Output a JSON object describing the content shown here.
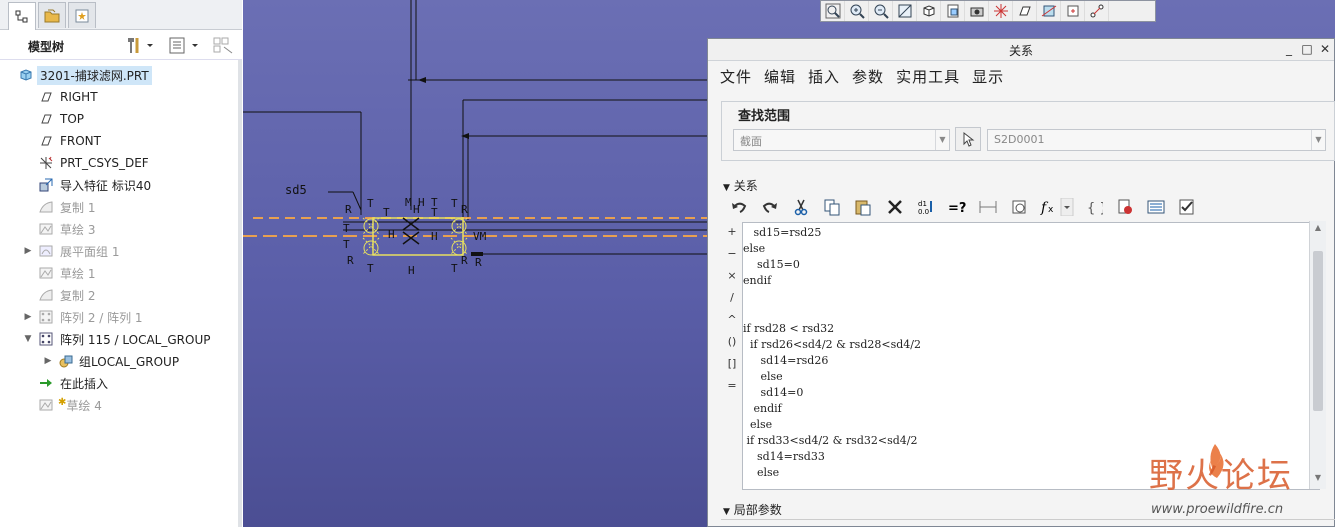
{
  "model_tree": {
    "header_title": "模型树",
    "items": [
      {
        "label": "3201-捕球滤网.PRT",
        "icon": "part-icon",
        "state": "selected"
      },
      {
        "label": "RIGHT",
        "icon": "datum-plane-icon",
        "state": "normal"
      },
      {
        "label": "TOP",
        "icon": "datum-plane-icon",
        "state": "normal"
      },
      {
        "label": "FRONT",
        "icon": "datum-plane-icon",
        "state": "normal"
      },
      {
        "label": "PRT_CSYS_DEF",
        "icon": "csys-icon",
        "state": "normal"
      },
      {
        "label": "导入特征 标识40",
        "icon": "import-feature-icon",
        "state": "normal"
      },
      {
        "label": "复制 1",
        "icon": "copy-icon",
        "state": "dim"
      },
      {
        "label": "草绘 3",
        "icon": "sketch-icon",
        "state": "dim"
      },
      {
        "label": "展平面组 1",
        "icon": "flatten-quilt-icon",
        "state": "dim"
      },
      {
        "label": "草绘 1",
        "icon": "sketch-icon",
        "state": "dim"
      },
      {
        "label": "复制 2",
        "icon": "copy-icon",
        "state": "dim"
      },
      {
        "label": "阵列 2 / 阵列 1",
        "icon": "pattern-icon",
        "state": "dim"
      },
      {
        "label": "阵列 115 / LOCAL_GROUP",
        "icon": "pattern-icon",
        "state": "normal"
      },
      {
        "label": "组LOCAL_GROUP",
        "icon": "group-icon",
        "state": "normal"
      },
      {
        "label": "在此插入",
        "icon": "insert-here-arrow-icon",
        "state": "normal"
      },
      {
        "label": "草绘 4",
        "icon": "sketch-icon",
        "state": "dim"
      }
    ]
  },
  "sketch": {
    "dim_label": "sd5",
    "marks": [
      "T",
      "T",
      "H",
      "T",
      "R",
      "T",
      "H",
      "R",
      "T",
      "H",
      "R",
      "T",
      "H",
      "T",
      "VM",
      "R",
      "T",
      "R",
      "T",
      "M",
      "H"
    ]
  },
  "dialog": {
    "title": "关系",
    "menus": [
      "文件",
      "编辑",
      "插入",
      "参数",
      "实用工具",
      "显示"
    ],
    "lookin_title": "查找范围",
    "lookin_type": "截面",
    "lookin_name": "S2D0001",
    "relations_title": "关系",
    "side_ops": [
      "+",
      "−",
      "×",
      "/",
      "^",
      "()",
      "[]",
      "="
    ],
    "relations_lines": [
      "   sd15=rsd25",
      "else",
      "    sd15=0",
      "endif",
      "",
      "",
      "if rsd28 < rsd32",
      "  if rsd26<sd4/2 & rsd28<sd4/2",
      "     sd14=rsd26",
      "     else",
      "     sd14=0",
      "   endif",
      "  else",
      " if rsd33<sd4/2 & rsd32<sd4/2",
      "    sd14=rsd33",
      "    else"
    ],
    "local_params_title": "局部参数"
  },
  "watermark": {
    "brand": "野火论坛",
    "url": "www.proewildfire.cn"
  }
}
